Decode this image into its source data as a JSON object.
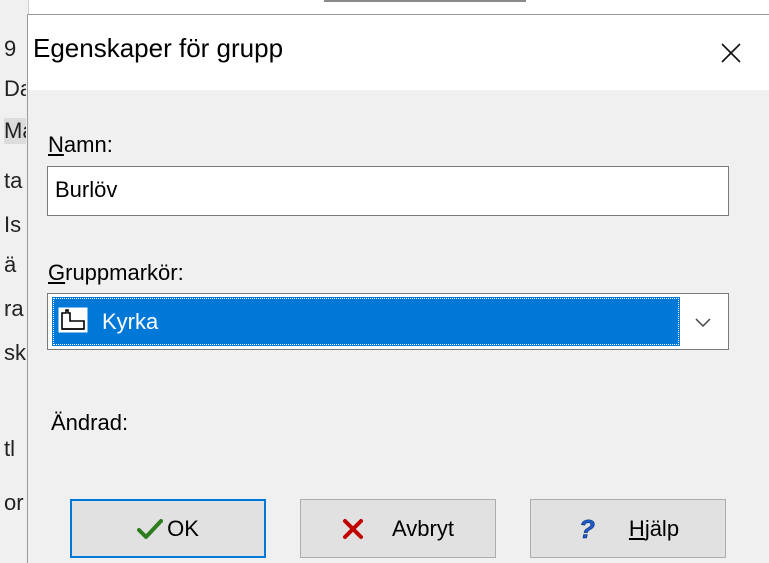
{
  "background_fragments": [
    "9",
    "Da",
    "Ma",
    "ta",
    "Is",
    "ä",
    "ra",
    "sk",
    "tl",
    "or"
  ],
  "dialog": {
    "title": "Egenskaper för grupp",
    "close_label": "×",
    "name_label_accel": "N",
    "name_label_rest": "amn:",
    "name_value": "Burlöv",
    "marker_label_accel": "G",
    "marker_label_rest": "ruppmarkör:",
    "marker_selected": "Kyrka",
    "changed_label": "Ändrad:",
    "changed_value": "",
    "buttons": {
      "ok": "OK",
      "cancel": "Avbryt",
      "help_accel": "H",
      "help_rest": "jälp"
    }
  },
  "colors": {
    "selection": "#0078d7",
    "ok_check": "#2d7d1e",
    "cancel_x": "#c00000",
    "help_q": "#1e5bc6"
  },
  "icons": {
    "close": "close-icon",
    "marker": "church-icon",
    "dropdown": "chevron-down-icon",
    "ok": "check-icon",
    "cancel": "x-icon",
    "help": "question-icon"
  }
}
